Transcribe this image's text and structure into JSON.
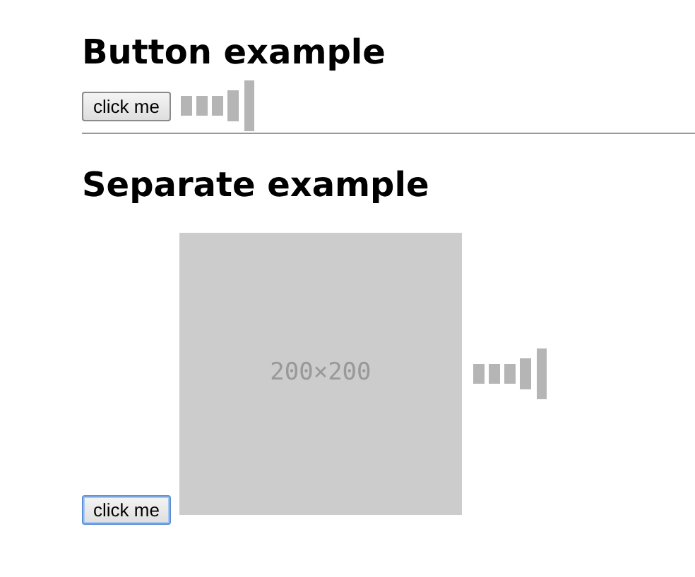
{
  "sections": [
    {
      "heading": "Button example",
      "button": {
        "label": "click me",
        "focused": false
      },
      "divider": true
    },
    {
      "heading": "Separate example",
      "button": {
        "label": "click me",
        "focused": true
      },
      "placeholder": {
        "label": "200×200"
      }
    }
  ]
}
